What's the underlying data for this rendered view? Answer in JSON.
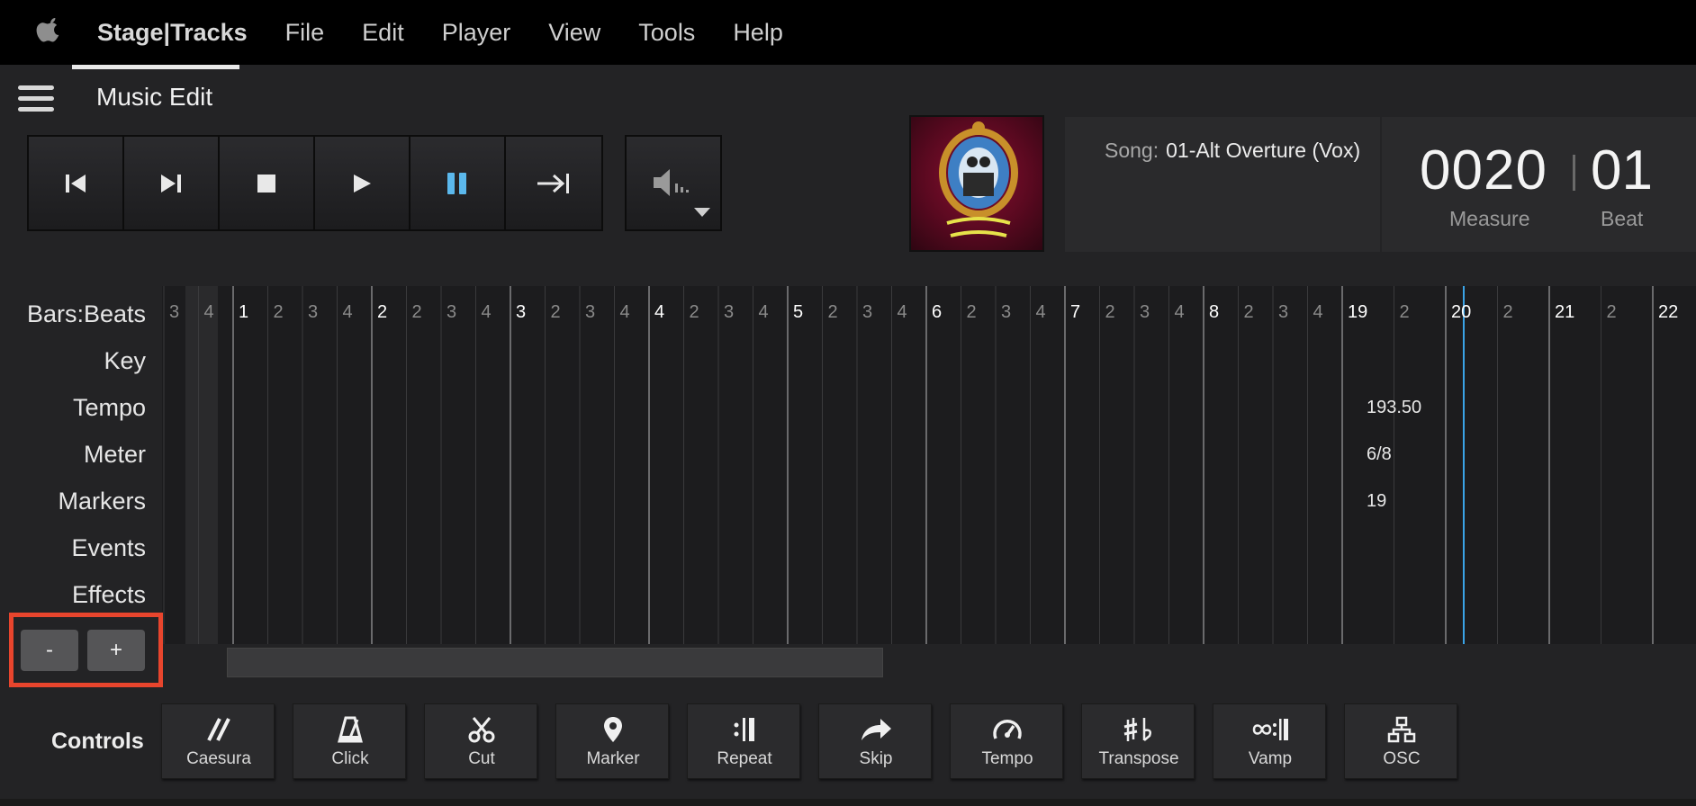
{
  "menubar": {
    "app_name": "Stage|Tracks",
    "items": [
      "File",
      "Edit",
      "Player",
      "View",
      "Tools",
      "Help"
    ]
  },
  "header": {
    "title": "Music Edit"
  },
  "transport": {
    "buttons": [
      "skip-back-icon",
      "skip-forward-icon",
      "stop-icon",
      "play-icon",
      "pause-icon",
      "go-to-end-icon"
    ],
    "active_button": "pause-icon",
    "active_color": "#5bb8ec"
  },
  "song": {
    "label": "Song:",
    "name": "01-Alt Overture (Vox)"
  },
  "counter": {
    "measure": "0020",
    "beat": "01",
    "measure_label": "Measure",
    "beat_label": "Beat"
  },
  "tracks": [
    "Bars:Beats",
    "Key",
    "Tempo",
    "Meter",
    "Markers",
    "Events",
    "Effects"
  ],
  "timeline": {
    "bars": [
      {
        "bar": "",
        "beats": [
          "3",
          "4"
        ]
      },
      {
        "bar": "1",
        "beats": [
          "2",
          "3",
          "4"
        ]
      },
      {
        "bar": "2",
        "beats": [
          "2",
          "3",
          "4"
        ]
      },
      {
        "bar": "3",
        "beats": [
          "2",
          "3",
          "4"
        ]
      },
      {
        "bar": "4",
        "beats": [
          "2",
          "3",
          "4"
        ]
      },
      {
        "bar": "5",
        "beats": [
          "2",
          "3",
          "4"
        ]
      },
      {
        "bar": "6",
        "beats": [
          "2",
          "3",
          "4"
        ]
      },
      {
        "bar": "7",
        "beats": [
          "2",
          "3",
          "4"
        ]
      },
      {
        "bar": "8",
        "beats": [
          "2",
          "3",
          "4"
        ]
      },
      {
        "bar": "19",
        "beats": [
          "2"
        ]
      },
      {
        "bar": "20",
        "beats": [
          "2"
        ]
      },
      {
        "bar": "21",
        "beats": [
          "2"
        ]
      },
      {
        "bar": "22",
        "beats": []
      }
    ],
    "leading_beat": "2",
    "tempo_value": "193.50",
    "meter_value": "6/8",
    "marker_value": "19",
    "playhead_color": "#3aa3e6"
  },
  "zoom": {
    "minus": "-",
    "plus": "+",
    "highlight_color": "#e8452d"
  },
  "controls": {
    "label": "Controls",
    "buttons": [
      {
        "label": "Caesura",
        "icon": "caesura-icon"
      },
      {
        "label": "Click",
        "icon": "metronome-icon"
      },
      {
        "label": "Cut",
        "icon": "scissors-icon"
      },
      {
        "label": "Marker",
        "icon": "map-pin-icon"
      },
      {
        "label": "Repeat",
        "icon": "repeat-sign-icon"
      },
      {
        "label": "Skip",
        "icon": "skip-arrow-icon"
      },
      {
        "label": "Tempo",
        "icon": "gauge-icon"
      },
      {
        "label": "Transpose",
        "icon": "sharp-flat-icon"
      },
      {
        "label": "Vamp",
        "icon": "vamp-icon"
      },
      {
        "label": "OSC",
        "icon": "network-icon"
      }
    ]
  }
}
